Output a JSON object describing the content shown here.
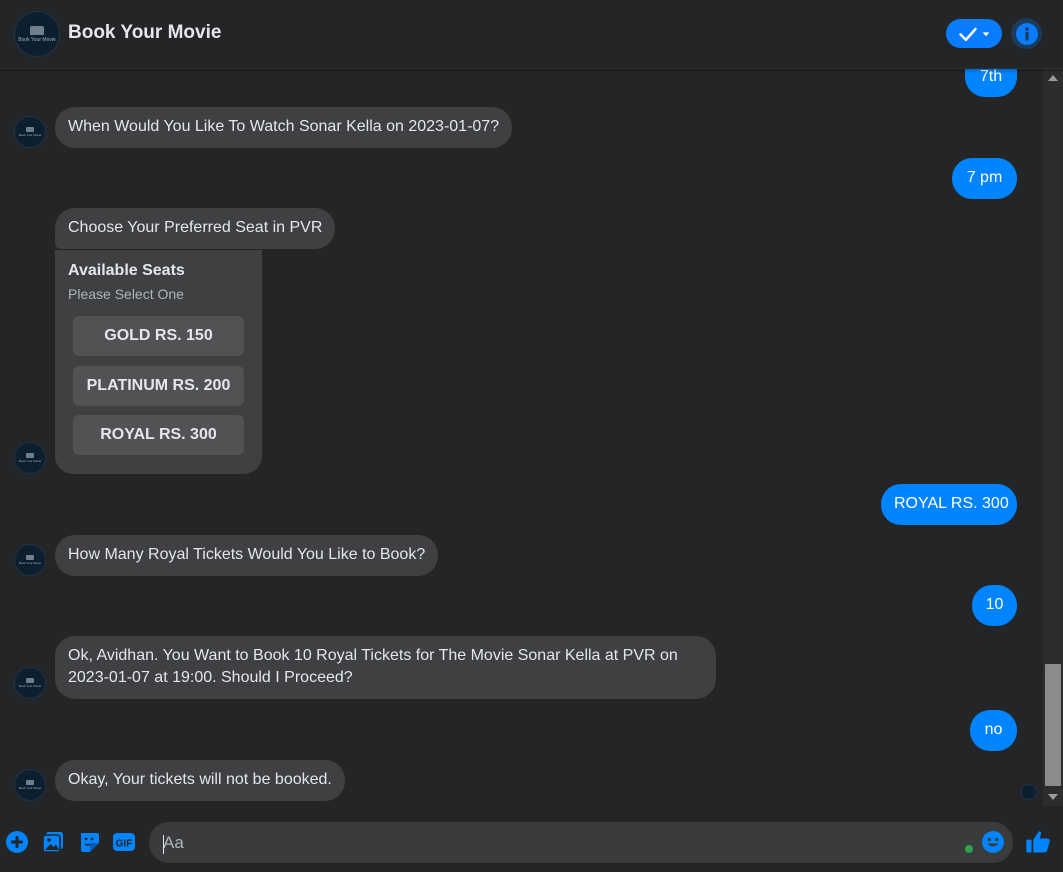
{
  "header": {
    "title": "Book Your Movie",
    "logo_text": "Book Your Movie",
    "accent_color": "#0084ff"
  },
  "messages": [
    {
      "from": "user",
      "text": "7th"
    },
    {
      "from": "bot",
      "text": "When Would You Like To Watch Sonar Kella on 2023-01-07?"
    },
    {
      "from": "user",
      "text": "7 pm"
    },
    {
      "from": "bot",
      "text": "Choose Your Preferred Seat in PVR"
    },
    {
      "from": "user",
      "text": "ROYAL RS. 300"
    },
    {
      "from": "bot",
      "text": "How Many Royal Tickets Would You Like to Book?"
    },
    {
      "from": "user",
      "text": "10"
    },
    {
      "from": "bot",
      "line1": "Ok, Avidhan. You Want to Book 10 Royal Tickets for The Movie Sonar Kella at PVR on",
      "line2": "2023-01-07 at 19:00. Should I Proceed?"
    },
    {
      "from": "user",
      "text": "no"
    },
    {
      "from": "bot",
      "text": "Okay, Your tickets will not be booked."
    }
  ],
  "seat_card": {
    "title": "Available Seats",
    "subtitle": "Please Select One",
    "options": [
      "GOLD RS. 150",
      "PLATINUM RS. 200",
      "ROYAL RS. 300"
    ]
  },
  "composer": {
    "placeholder": "Aa",
    "tools": [
      "plus-icon",
      "image-icon",
      "sticker-icon",
      "gif-icon"
    ],
    "gif_label": "GIF"
  }
}
